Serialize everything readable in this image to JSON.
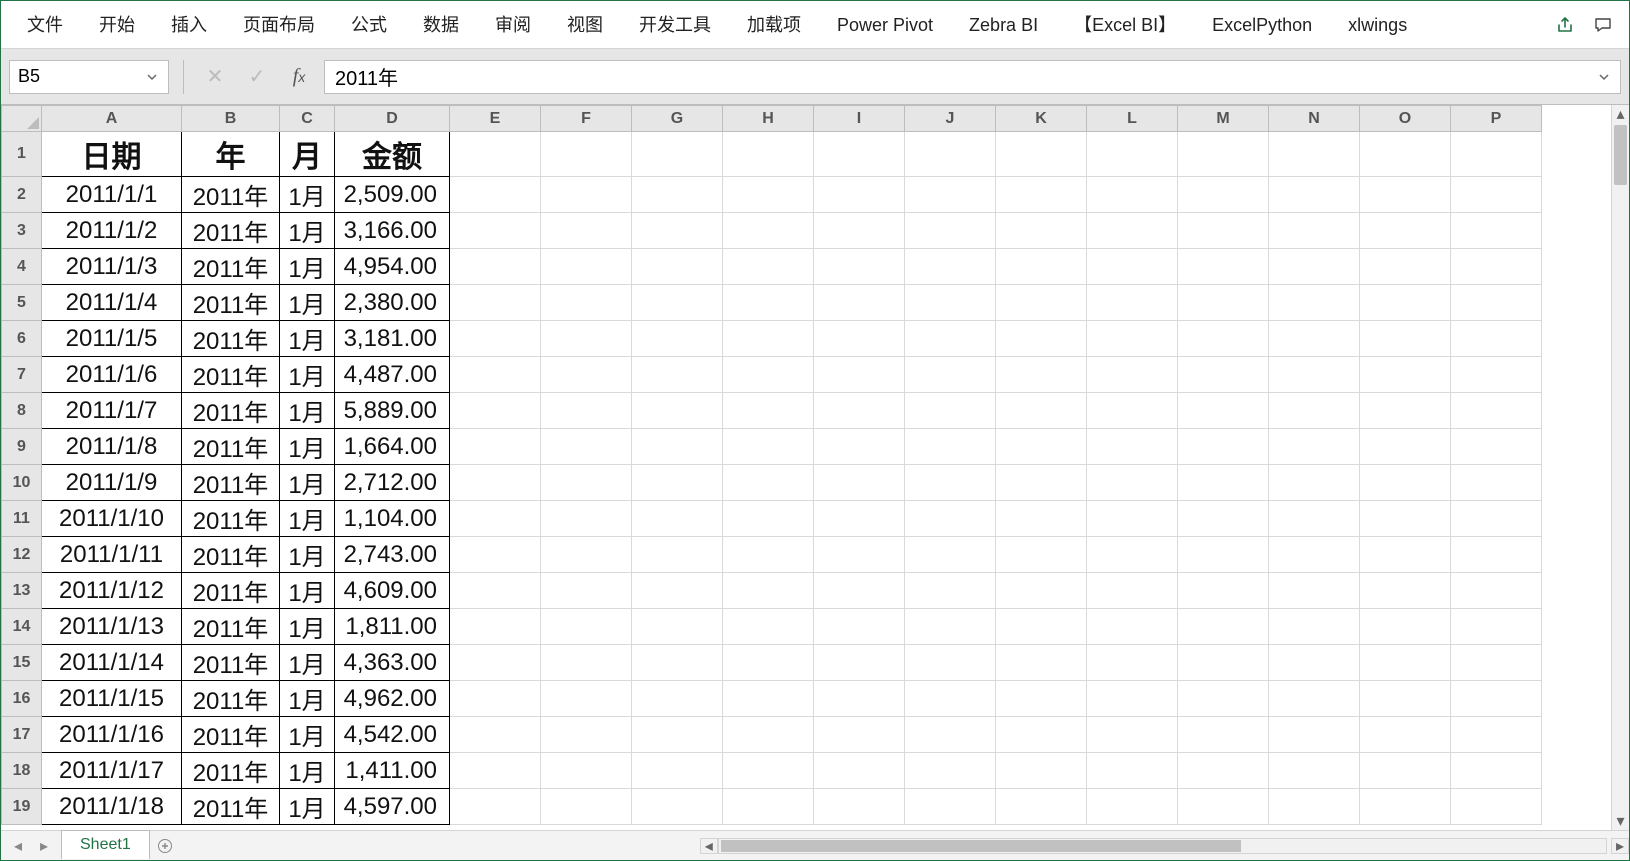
{
  "ribbon": {
    "tabs": [
      "文件",
      "开始",
      "插入",
      "页面布局",
      "公式",
      "数据",
      "审阅",
      "视图",
      "开发工具",
      "加载项",
      "Power Pivot",
      "Zebra BI",
      "【Excel BI】",
      "ExcelPython",
      "xlwings"
    ]
  },
  "name_box": {
    "value": "B5"
  },
  "formula_bar": {
    "value": "2011年"
  },
  "columns": [
    "A",
    "B",
    "C",
    "D",
    "E",
    "F",
    "G",
    "H",
    "I",
    "J",
    "K",
    "L",
    "M",
    "N",
    "O",
    "P"
  ],
  "row_numbers": [
    1,
    2,
    3,
    4,
    5,
    6,
    7,
    8,
    9,
    10,
    11,
    12,
    13,
    14,
    15,
    16,
    17,
    18,
    19
  ],
  "headers": {
    "A": "日期",
    "B": "年",
    "C": "月",
    "D": "金额"
  },
  "rows": [
    {
      "date": "2011/1/1",
      "year": "2011年",
      "month": "1月",
      "amount": "2,509.00"
    },
    {
      "date": "2011/1/2",
      "year": "2011年",
      "month": "1月",
      "amount": "3,166.00"
    },
    {
      "date": "2011/1/3",
      "year": "2011年",
      "month": "1月",
      "amount": "4,954.00"
    },
    {
      "date": "2011/1/4",
      "year": "2011年",
      "month": "1月",
      "amount": "2,380.00"
    },
    {
      "date": "2011/1/5",
      "year": "2011年",
      "month": "1月",
      "amount": "3,181.00"
    },
    {
      "date": "2011/1/6",
      "year": "2011年",
      "month": "1月",
      "amount": "4,487.00"
    },
    {
      "date": "2011/1/7",
      "year": "2011年",
      "month": "1月",
      "amount": "5,889.00"
    },
    {
      "date": "2011/1/8",
      "year": "2011年",
      "month": "1月",
      "amount": "1,664.00"
    },
    {
      "date": "2011/1/9",
      "year": "2011年",
      "month": "1月",
      "amount": "2,712.00"
    },
    {
      "date": "2011/1/10",
      "year": "2011年",
      "month": "1月",
      "amount": "1,104.00"
    },
    {
      "date": "2011/1/11",
      "year": "2011年",
      "month": "1月",
      "amount": "2,743.00"
    },
    {
      "date": "2011/1/12",
      "year": "2011年",
      "month": "1月",
      "amount": "4,609.00"
    },
    {
      "date": "2011/1/13",
      "year": "2011年",
      "month": "1月",
      "amount": "1,811.00"
    },
    {
      "date": "2011/1/14",
      "year": "2011年",
      "month": "1月",
      "amount": "4,363.00"
    },
    {
      "date": "2011/1/15",
      "year": "2011年",
      "month": "1月",
      "amount": "4,962.00"
    },
    {
      "date": "2011/1/16",
      "year": "2011年",
      "month": "1月",
      "amount": "4,542.00"
    },
    {
      "date": "2011/1/17",
      "year": "2011年",
      "month": "1月",
      "amount": "1,411.00"
    },
    {
      "date": "2011/1/18",
      "year": "2011年",
      "month": "1月",
      "amount": "4,597.00"
    }
  ],
  "sheet_tabs": {
    "active": "Sheet1"
  }
}
